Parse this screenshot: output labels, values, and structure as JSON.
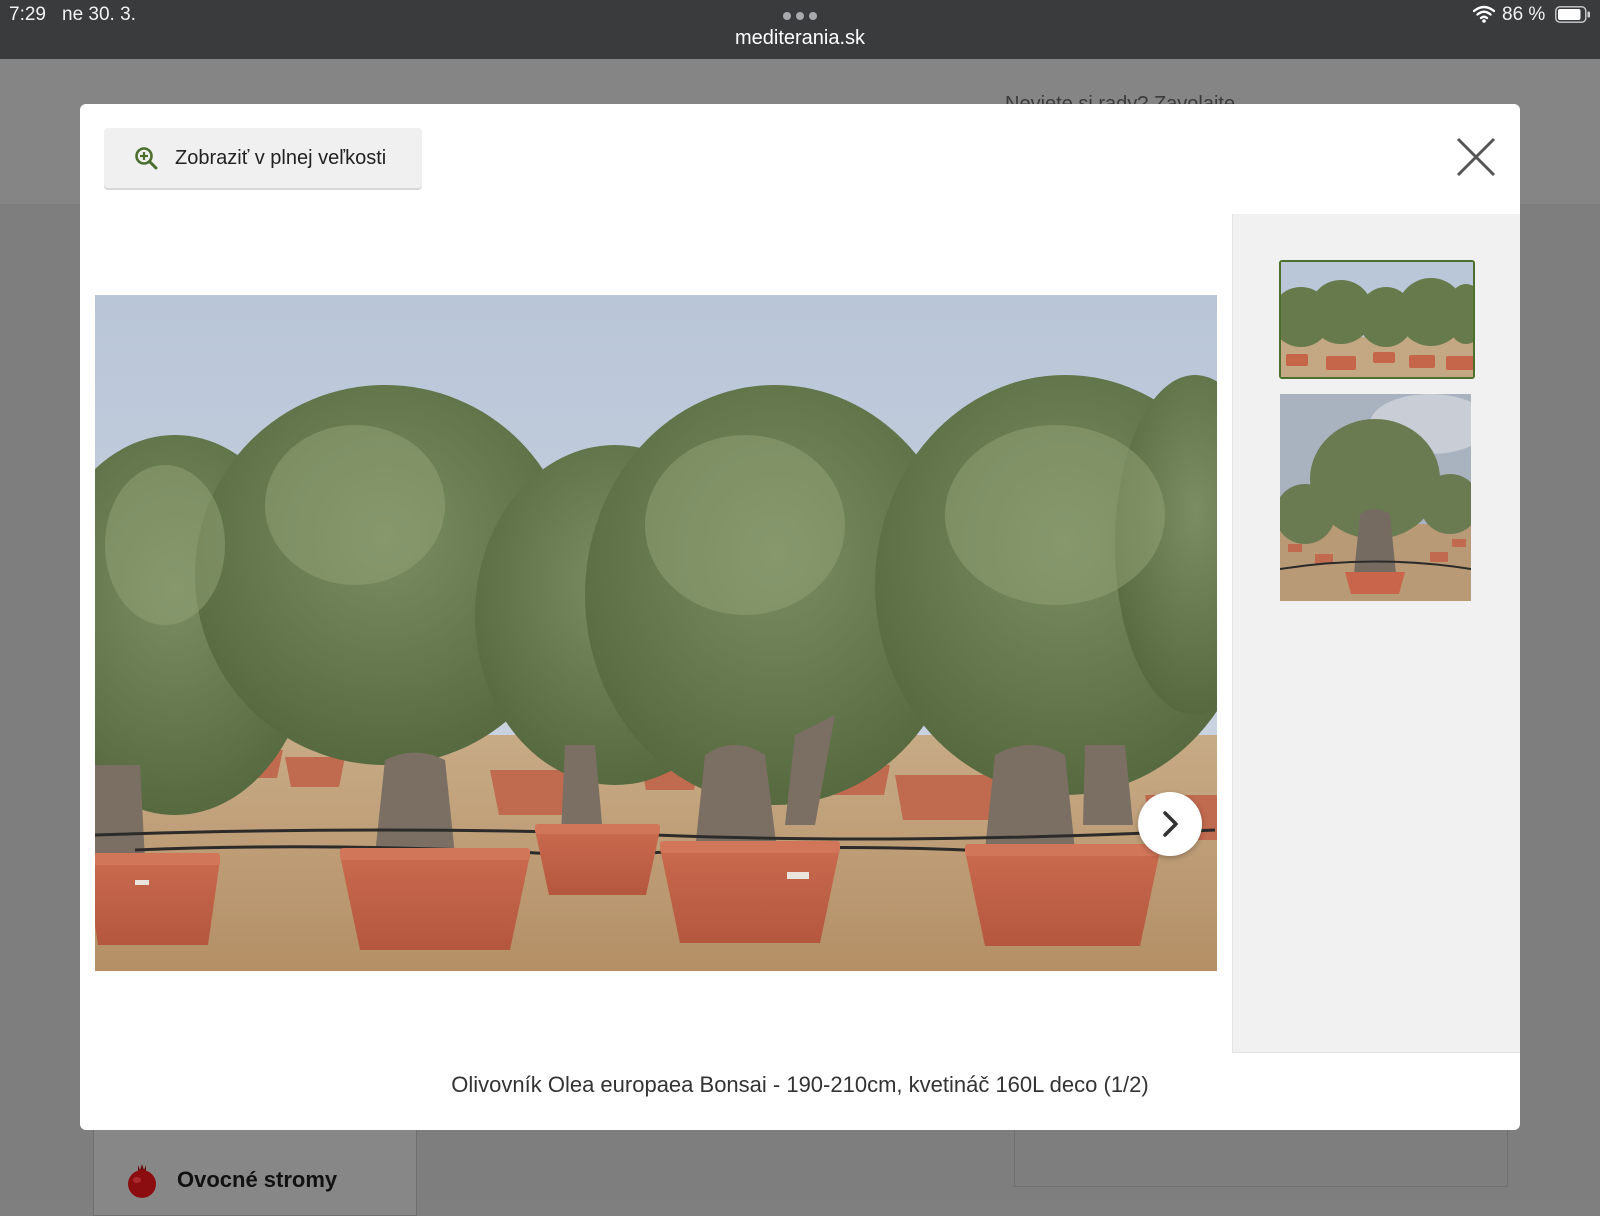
{
  "status_bar": {
    "time": "7:29",
    "date": "ne 30. 3.",
    "url": "mediterania.sk",
    "battery": "86 %"
  },
  "background_page": {
    "header_text": "Neviete si rady? Zavolajte",
    "category": {
      "label": "Ovocné stromy",
      "icon": "pomegranate-icon"
    }
  },
  "modal": {
    "fullsize_button": {
      "label": "Zobraziť v plnej veľkosti",
      "icon": "zoom-in-icon"
    },
    "close_icon": "close-icon",
    "next_icon": "chevron-right-icon",
    "caption": "Olivovník Olea europaea Bonsai - 190-210cm, kvetináč 160L deco  (1/2)",
    "thumbnails": [
      {
        "selected": true
      },
      {
        "selected": false
      }
    ]
  },
  "colors": {
    "status_bar": "#3a3b3d",
    "accent_green": "#4d6f2d",
    "cart_green": "#0d6b29",
    "modal_bg": "#ffffff",
    "thumb_panel": "#f1f1f1"
  }
}
